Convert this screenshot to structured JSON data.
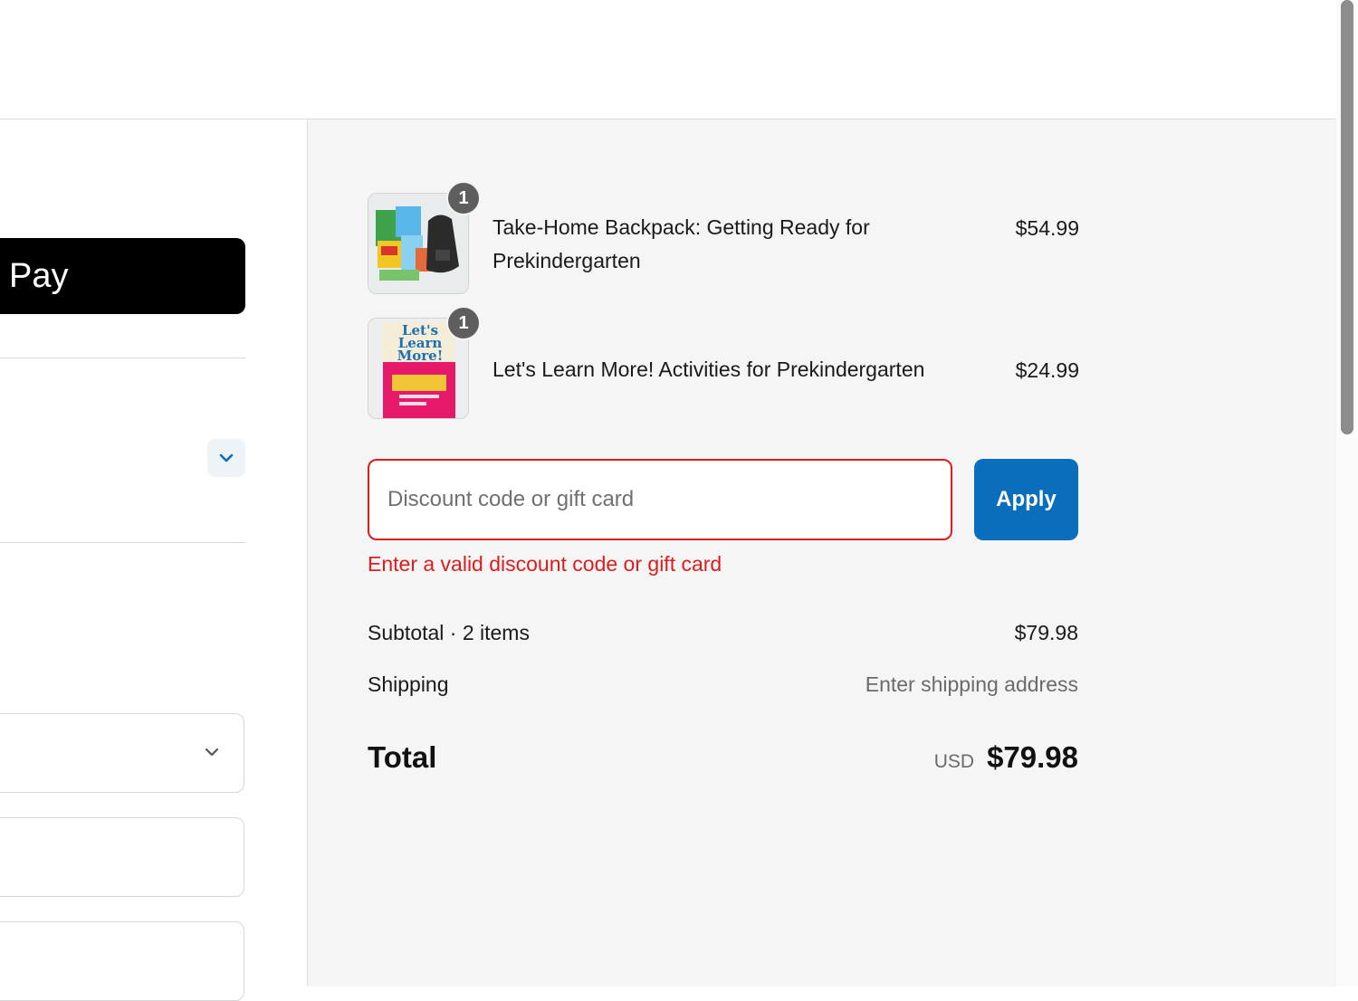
{
  "express_checkout": {
    "pay_label": "Pay"
  },
  "cart": {
    "items": [
      {
        "title": "Take-Home Backpack: Getting Ready for Prekindergarten",
        "price": "$54.99",
        "quantity": "1"
      },
      {
        "title": "Let's Learn More! Activities for Prekindergarten",
        "price": "$24.99",
        "quantity": "1",
        "thumbnail_text": "Let's Learn More!"
      }
    ]
  },
  "discount": {
    "placeholder": "Discount code or gift card",
    "apply_label": "Apply",
    "error": "Enter a valid discount code or gift card"
  },
  "summary": {
    "subtotal_label": "Subtotal · 2 items",
    "subtotal_value": "$79.98",
    "shipping_label": "Shipping",
    "shipping_value": "Enter shipping address",
    "total_label": "Total",
    "currency": "USD",
    "total_value": "$79.98"
  },
  "colors": {
    "primary": "#0a6ebd",
    "error": "#dd1d1d",
    "sidebar_bg": "#f5f5f5"
  }
}
